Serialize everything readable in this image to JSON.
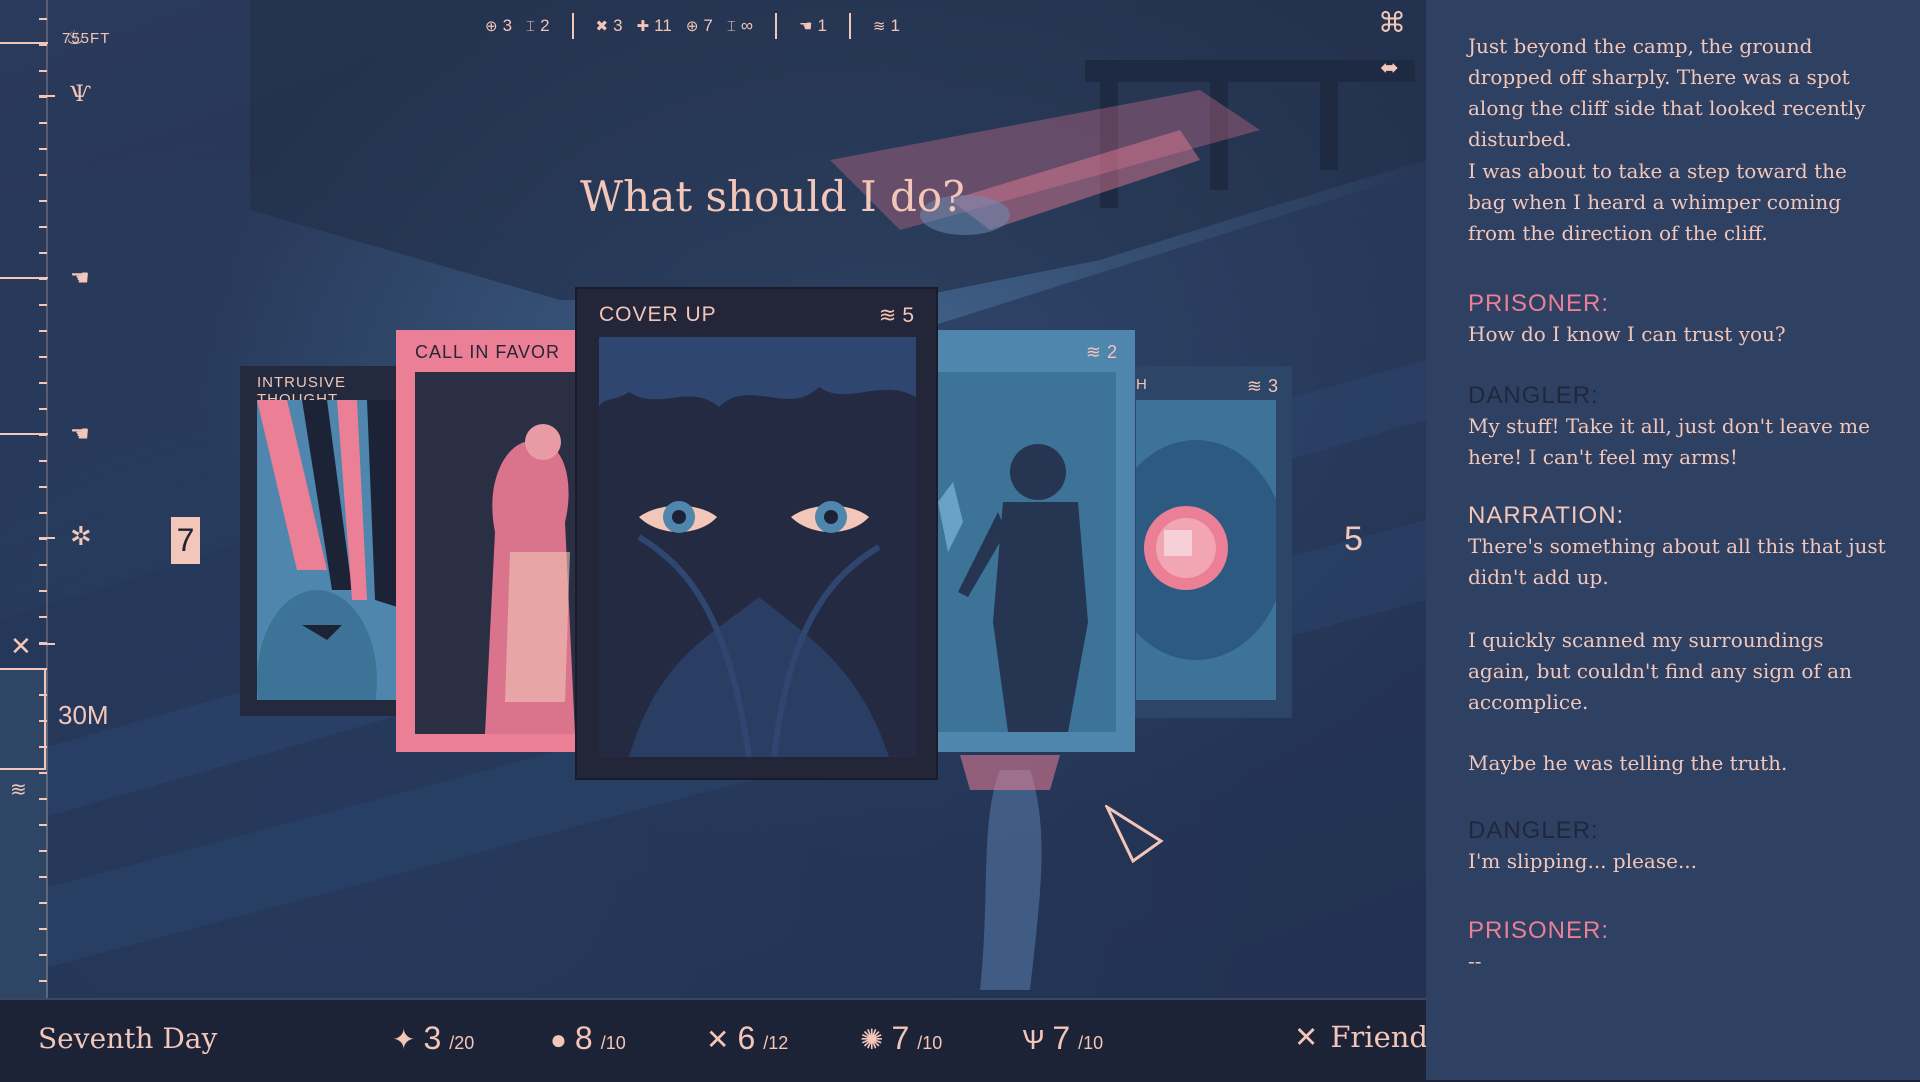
{
  "depth": {
    "top_label": "755FT",
    "marker_label": "30M"
  },
  "top_stats": {
    "group1": [
      {
        "icon": "target-icon",
        "glyph": "⊕",
        "value": "3"
      },
      {
        "icon": "tower-icon",
        "glyph": "⌶",
        "value": "2"
      }
    ],
    "group2": [
      {
        "icon": "claw-icon",
        "glyph": "✖",
        "value": "3"
      },
      {
        "icon": "cross-icon",
        "glyph": "✚",
        "value": "11"
      },
      {
        "icon": "target-icon",
        "glyph": "⊕",
        "value": "7"
      },
      {
        "icon": "tower-icon",
        "glyph": "⌶",
        "value": "∞"
      }
    ],
    "group3": [
      {
        "icon": "hand-icon",
        "glyph": "☚",
        "value": "1"
      }
    ],
    "group4": [
      {
        "icon": "wave-icon",
        "glyph": "≋",
        "value": "1"
      }
    ]
  },
  "question": "What should I do?",
  "hand": {
    "left_count": "7",
    "right_count": "5",
    "cards": [
      {
        "title": "INTRUSIVE THOUGHT",
        "cost": ""
      },
      {
        "title": "CALL IN FAVOR",
        "cost": ""
      },
      {
        "title": "COVER UP",
        "cost": "5"
      },
      {
        "title": "",
        "cost": "2"
      },
      {
        "title": "H",
        "cost": "3"
      }
    ]
  },
  "bottom": {
    "day": "Seventh Day",
    "resources": [
      {
        "icon": "water-drop-icon",
        "glyph": "💧",
        "value": "3",
        "max": "/20"
      },
      {
        "icon": "food-icon",
        "glyph": "●",
        "value": "8",
        "max": "/10"
      },
      {
        "icon": "crossed-tools-icon",
        "glyph": "✕",
        "value": "6",
        "max": "/12"
      },
      {
        "icon": "spiky-icon",
        "glyph": "✺",
        "value": "7",
        "max": "/10"
      },
      {
        "icon": "claw-icon",
        "glyph": "Ѱ",
        "value": "7",
        "max": "/10"
      }
    ],
    "status": "Friend"
  },
  "narrative": {
    "p1": "Just beyond the camp, the ground dropped off sharply. There was a spot along the cliff side that looked recently disturbed.",
    "p2": "I was about to take a step toward the bag when I heard a whimper coming from the direction of the cliff.",
    "s1_speaker": "PRISONER:",
    "s1_text": "How do I know I can trust you?",
    "s2_speaker": "DANGLER:",
    "s2_text": "My stuff! Take it all, just don't leave me here! I can't feel my arms!",
    "s3_speaker": "NARRATION:",
    "s3_text": "There's something about all this that just didn't add up.",
    "p3": "I quickly scanned my surroundings again, but couldn't find any sign of an accomplice.",
    "p4": "Maybe he was telling the truth.",
    "s4_speaker": "DANGLER:",
    "s4_text": "I'm slipping... please...",
    "s5_speaker": "PRISONER:",
    "s5_text": "--"
  },
  "colors": {
    "accent_pink": "#ea7f96",
    "cream": "#f2c6b8",
    "navy": "#1d2336",
    "panel": "#2f4163",
    "card_blue": "#3c7396"
  }
}
